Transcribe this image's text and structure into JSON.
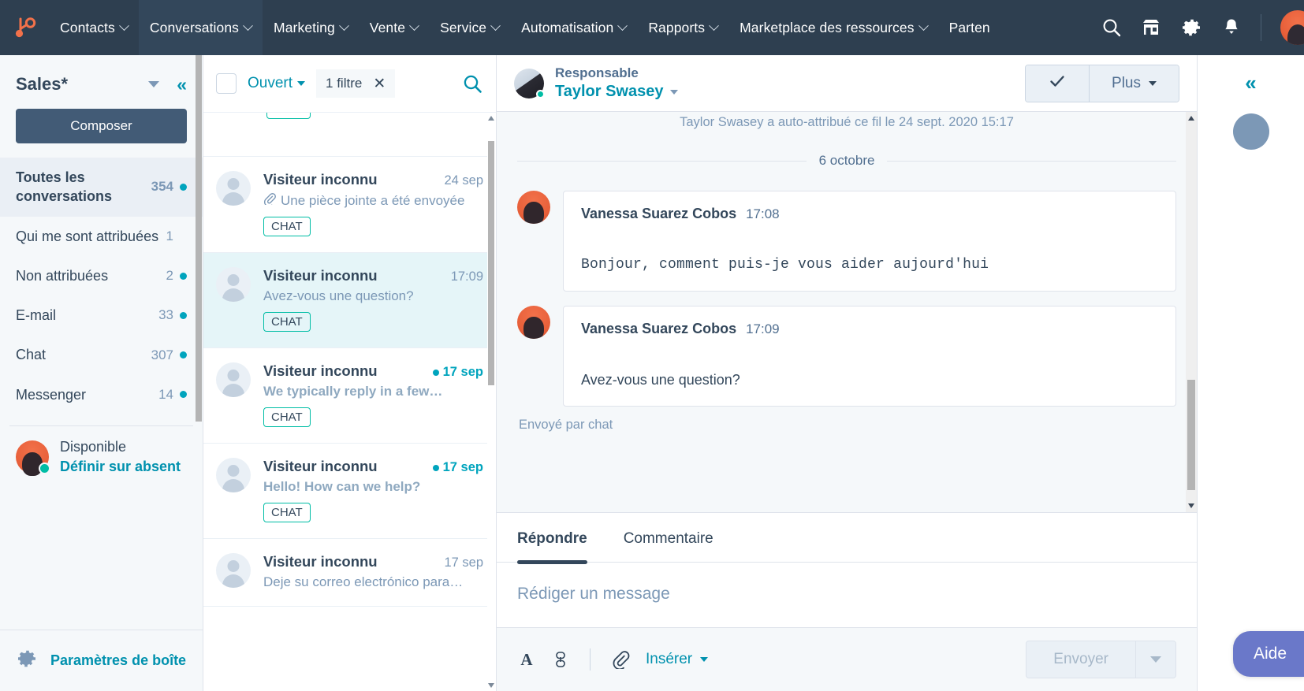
{
  "topnav": {
    "logo_icon": "hubspot-logo",
    "items": [
      {
        "label": "Contacts",
        "has_caret": true,
        "active": false
      },
      {
        "label": "Conversations",
        "has_caret": true,
        "active": true
      },
      {
        "label": "Marketing",
        "has_caret": true,
        "active": false
      },
      {
        "label": "Vente",
        "has_caret": true,
        "active": false
      },
      {
        "label": "Service",
        "has_caret": true,
        "active": false
      },
      {
        "label": "Automatisation",
        "has_caret": true,
        "active": false
      },
      {
        "label": "Rapports",
        "has_caret": true,
        "active": false
      },
      {
        "label": "Marketplace des ressources",
        "has_caret": true,
        "active": false
      },
      {
        "label": "Parten",
        "has_caret": false,
        "active": false
      }
    ],
    "icons": [
      "search-icon",
      "marketplace-icon",
      "settings-gear-icon",
      "notifications-bell-icon"
    ]
  },
  "sidebar": {
    "title": "Sales*",
    "compose_label": "Composer",
    "items": [
      {
        "label": "Toutes les conversations",
        "count": "354",
        "dot": true,
        "active": true
      },
      {
        "label": "Qui me sont attribuées",
        "count": "1",
        "dot": false,
        "active": false
      },
      {
        "label": "Non attribuées",
        "count": "2",
        "dot": true,
        "active": false
      },
      {
        "label": "E-mail",
        "count": "33",
        "dot": true,
        "active": false
      },
      {
        "label": "Chat",
        "count": "307",
        "dot": true,
        "active": false
      },
      {
        "label": "Messenger",
        "count": "14",
        "dot": true,
        "active": false
      }
    ],
    "user": {
      "status": "Disponible",
      "away_action": "Définir sur absent"
    },
    "footer": {
      "label": "Paramètres de boîte",
      "icon": "gear-icon"
    }
  },
  "conversation_list": {
    "sort_label": "Ouvert",
    "filter_chip": "1 filtre",
    "search_icon": "search-icon",
    "items": [
      {
        "name": "Visiteur inconnu",
        "time": "24 sep",
        "preview": "Une pièce jointe a été envoyée",
        "has_attachment": true,
        "badge": "CHAT",
        "unread": false,
        "selected": false
      },
      {
        "name": "Visiteur inconnu",
        "time": "17:09",
        "preview": "Avez-vous une question?",
        "has_attachment": false,
        "badge": "CHAT",
        "unread": false,
        "selected": true
      },
      {
        "name": "Visiteur inconnu",
        "time": "17 sep",
        "preview": "We typically reply in a few…",
        "has_attachment": false,
        "badge": "CHAT",
        "unread": true,
        "selected": false
      },
      {
        "name": "Visiteur inconnu",
        "time": "17 sep",
        "preview": "Hello! How can we help?",
        "has_attachment": false,
        "badge": "CHAT",
        "unread": true,
        "selected": false
      },
      {
        "name": "Visiteur inconnu",
        "time": "17 sep",
        "preview": "Deje su correo electrónico para…",
        "has_attachment": false,
        "badge": "CHAT",
        "unread": false,
        "selected": false
      }
    ]
  },
  "thread": {
    "owner_role": "Responsable",
    "owner_name": "Taylor Swasey",
    "close_icon": "checkmark-icon",
    "more_label": "Plus",
    "system_note": "Taylor Swasey a auto-attribué ce fil le 24 sept. 2020 15:17",
    "date_divider": "6 octobre",
    "messages": [
      {
        "author": "Vanessa Suarez Cobos",
        "time": "17:08",
        "body": "Bonjour, comment puis-je vous aider aujourd'hui",
        "mono": true
      },
      {
        "author": "Vanessa Suarez Cobos",
        "time": "17:09",
        "body": "Avez-vous une question?",
        "mono": false
      }
    ],
    "sent_via": "Envoyé par chat"
  },
  "composer": {
    "tabs": [
      {
        "label": "Répondre",
        "active": true
      },
      {
        "label": "Commentaire",
        "active": false
      }
    ],
    "placeholder": "Rédiger un message",
    "toolbar": {
      "font_icon": "font-color-icon",
      "link_icon": "link-icon",
      "attach_icon": "paperclip-icon",
      "insert_label": "Insérer"
    },
    "send_label": "Envoyer"
  },
  "right_panel": {
    "collapse_icon": "double-chevron-left-icon",
    "avatar_icon": "contact-avatar"
  },
  "help_fab": {
    "label": "Aide",
    "color": "#6a78c9"
  },
  "colors": {
    "nav_bg": "#2e3f50",
    "nav_active": "#33475b",
    "brand_orange": "#f2714a",
    "teal": "#00a4bd",
    "link_teal": "#0091ae",
    "selected_row": "#e5f5f8",
    "sidebar_bg": "#f5f8fa",
    "text_dark": "#33475b",
    "text_muted": "#7c98b6"
  }
}
